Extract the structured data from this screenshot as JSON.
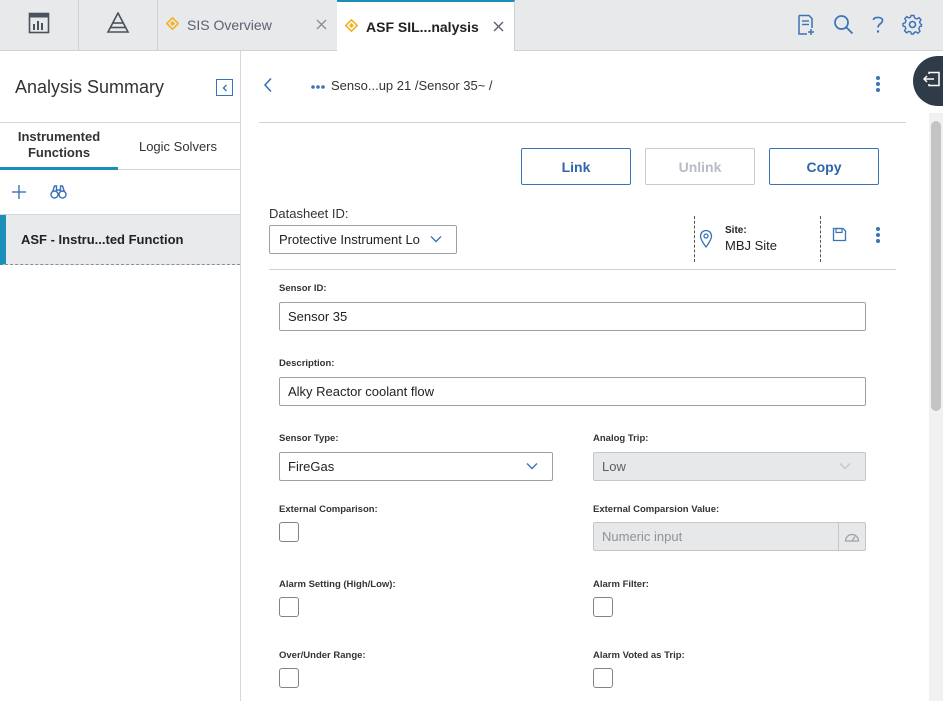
{
  "topbar": {
    "tabs": [
      {
        "label": "SIS Overview"
      },
      {
        "label": "ASF SIL...nalysis"
      }
    ]
  },
  "left": {
    "title": "Analysis Summary",
    "tabs": [
      {
        "label": "Instrumented Functions"
      },
      {
        "label": "Logic Solvers"
      }
    ],
    "items": [
      {
        "label": "ASF - Instru...ted Function"
      }
    ]
  },
  "header": {
    "breadcrumb": "Senso...up 21 /Sensor 35~ /"
  },
  "actions": {
    "link": "Link",
    "unlink": "Unlink",
    "copy": "Copy"
  },
  "datasheet": {
    "label": "Datasheet ID:",
    "value": "Protective Instrument Lo",
    "site_label": "Site:",
    "site_value": "MBJ Site"
  },
  "form": {
    "sensor_id": {
      "label": "Sensor ID:",
      "value": "Sensor 35"
    },
    "description": {
      "label": "Description:",
      "value": "Alky Reactor coolant flow"
    },
    "sensor_type": {
      "label": "Sensor Type:",
      "value": "FireGas"
    },
    "analog_trip": {
      "label": "Analog Trip:",
      "value": "Low"
    },
    "external_comparison": {
      "label": "External Comparison:"
    },
    "external_comparison_value": {
      "label": "External Comparsion Value:",
      "placeholder": "Numeric input"
    },
    "alarm_setting": {
      "label": "Alarm Setting (High/Low):"
    },
    "alarm_filter": {
      "label": "Alarm Filter:"
    },
    "over_under_range": {
      "label": "Over/Under Range:"
    },
    "alarm_voted_as_trip": {
      "label": "Alarm Voted as Trip:"
    }
  },
  "colors": {
    "accent": "#1a8fb7",
    "button_blue": "#3a73b8",
    "tab_diamond": "#f0b323"
  }
}
